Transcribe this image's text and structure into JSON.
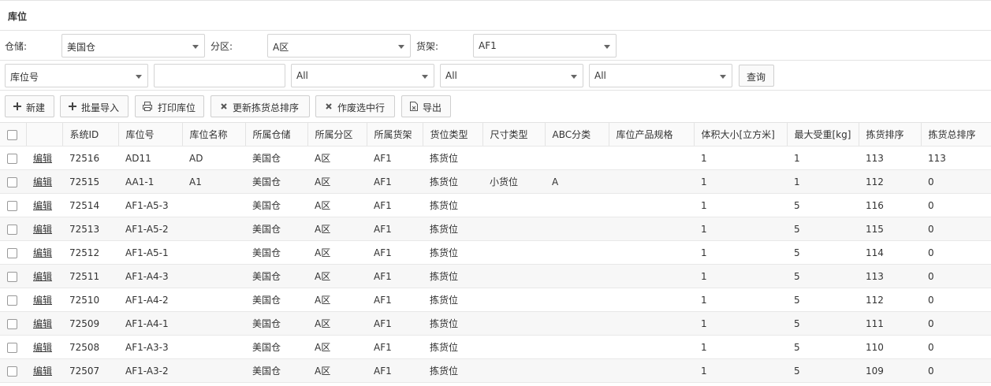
{
  "page": {
    "title": "库位"
  },
  "filters": {
    "warehouse_label": "仓储:",
    "warehouse_value": "美国仓",
    "zone_label": "分区:",
    "zone_value": "A区",
    "shelf_label": "货架:",
    "shelf_value": "AF1",
    "field_select": "库位号",
    "search_value": "",
    "select1": "All",
    "select2": "All",
    "select3": "All",
    "query_label": "查询"
  },
  "toolbar": {
    "new_label": "新建",
    "import_label": "批量导入",
    "print_label": "打印库位",
    "update_sort_label": "更新拣货总排序",
    "void_label": "作废选中行",
    "export_label": "导出"
  },
  "table": {
    "headers": [
      "",
      "系统ID",
      "库位号",
      "库位名称",
      "所属仓储",
      "所属分区",
      "所属货架",
      "货位类型",
      "尺寸类型",
      "ABC分类",
      "库位产品规格",
      "体积大小[立方米]",
      "最大受重[kg]",
      "拣货排序",
      "拣货总排序"
    ],
    "edit_label": "编辑",
    "rows": [
      {
        "id": "72516",
        "code": "AD11",
        "name": "AD",
        "wh": "美国仓",
        "zone": "A区",
        "shelf": "AF1",
        "type": "拣货位",
        "size": "",
        "abc": "",
        "spec": "",
        "vol": "1",
        "weight": "1",
        "sort": "113",
        "total": "113"
      },
      {
        "id": "72515",
        "code": "AA1-1",
        "name": "A1",
        "wh": "美国仓",
        "zone": "A区",
        "shelf": "AF1",
        "type": "拣货位",
        "size": "小货位",
        "abc": "A",
        "spec": "",
        "vol": "1",
        "weight": "1",
        "sort": "112",
        "total": "0"
      },
      {
        "id": "72514",
        "code": "AF1-A5-3",
        "name": "",
        "wh": "美国仓",
        "zone": "A区",
        "shelf": "AF1",
        "type": "拣货位",
        "size": "",
        "abc": "",
        "spec": "",
        "vol": "1",
        "weight": "5",
        "sort": "116",
        "total": "0"
      },
      {
        "id": "72513",
        "code": "AF1-A5-2",
        "name": "",
        "wh": "美国仓",
        "zone": "A区",
        "shelf": "AF1",
        "type": "拣货位",
        "size": "",
        "abc": "",
        "spec": "",
        "vol": "1",
        "weight": "5",
        "sort": "115",
        "total": "0"
      },
      {
        "id": "72512",
        "code": "AF1-A5-1",
        "name": "",
        "wh": "美国仓",
        "zone": "A区",
        "shelf": "AF1",
        "type": "拣货位",
        "size": "",
        "abc": "",
        "spec": "",
        "vol": "1",
        "weight": "5",
        "sort": "114",
        "total": "0"
      },
      {
        "id": "72511",
        "code": "AF1-A4-3",
        "name": "",
        "wh": "美国仓",
        "zone": "A区",
        "shelf": "AF1",
        "type": "拣货位",
        "size": "",
        "abc": "",
        "spec": "",
        "vol": "1",
        "weight": "5",
        "sort": "113",
        "total": "0"
      },
      {
        "id": "72510",
        "code": "AF1-A4-2",
        "name": "",
        "wh": "美国仓",
        "zone": "A区",
        "shelf": "AF1",
        "type": "拣货位",
        "size": "",
        "abc": "",
        "spec": "",
        "vol": "1",
        "weight": "5",
        "sort": "112",
        "total": "0"
      },
      {
        "id": "72509",
        "code": "AF1-A4-1",
        "name": "",
        "wh": "美国仓",
        "zone": "A区",
        "shelf": "AF1",
        "type": "拣货位",
        "size": "",
        "abc": "",
        "spec": "",
        "vol": "1",
        "weight": "5",
        "sort": "111",
        "total": "0"
      },
      {
        "id": "72508",
        "code": "AF1-A3-3",
        "name": "",
        "wh": "美国仓",
        "zone": "A区",
        "shelf": "AF1",
        "type": "拣货位",
        "size": "",
        "abc": "",
        "spec": "",
        "vol": "1",
        "weight": "5",
        "sort": "110",
        "total": "0"
      },
      {
        "id": "72507",
        "code": "AF1-A3-2",
        "name": "",
        "wh": "美国仓",
        "zone": "A区",
        "shelf": "AF1",
        "type": "拣货位",
        "size": "",
        "abc": "",
        "spec": "",
        "vol": "1",
        "weight": "5",
        "sort": "109",
        "total": "0"
      }
    ]
  }
}
